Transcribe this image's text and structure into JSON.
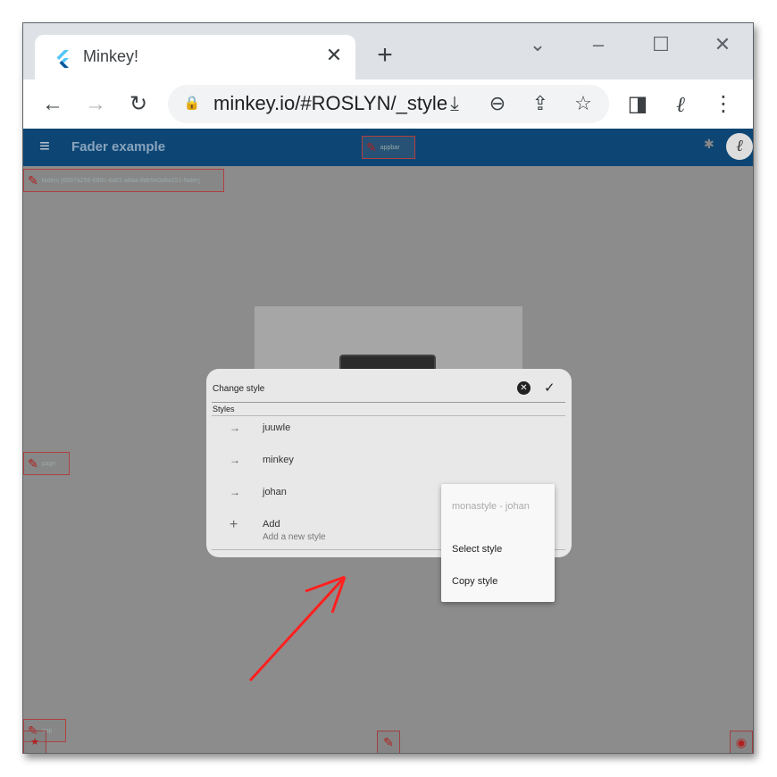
{
  "browser": {
    "tab_title": "Minkey!",
    "url": "minkey.io/#ROSLYN/_style",
    "colors": {
      "tabstrip": "#dee1e6",
      "toolbar": "#ffffff"
    }
  },
  "app": {
    "title": "Fader example",
    "appbar_tag": "appbar",
    "faders_tag": "faders [6507a255-680c-4a61-a6aa-9de5e0a6a151-fader]",
    "page_tag": "page",
    "bottom_tag": "app",
    "colors": {
      "appbar": "#0d4674",
      "overlay": "#8c8c8c",
      "tag_border": "#b04040"
    }
  },
  "dialog": {
    "title": "Change style",
    "section_label": "Styles",
    "styles": [
      {
        "label": "juuwle"
      },
      {
        "label": "minkey"
      },
      {
        "label": "johan"
      }
    ],
    "add": {
      "label": "Add",
      "sublabel": "Add a new style"
    }
  },
  "context_menu": {
    "header": "monastyle - johan",
    "items": [
      {
        "label": "Select style"
      },
      {
        "label": "Copy style"
      }
    ]
  },
  "icons": {
    "favicon": "flutter-icon",
    "back": "arrow-back-icon",
    "forward": "arrow-forward-icon",
    "reload": "reload-icon",
    "lock": "lock-icon",
    "install": "install-icon",
    "zoom": "zoom-out-icon",
    "share": "share-icon",
    "star": "star-icon",
    "sidepanel": "side-panel-icon",
    "extension": "extension-icon",
    "menu": "kebab-menu-icon"
  }
}
